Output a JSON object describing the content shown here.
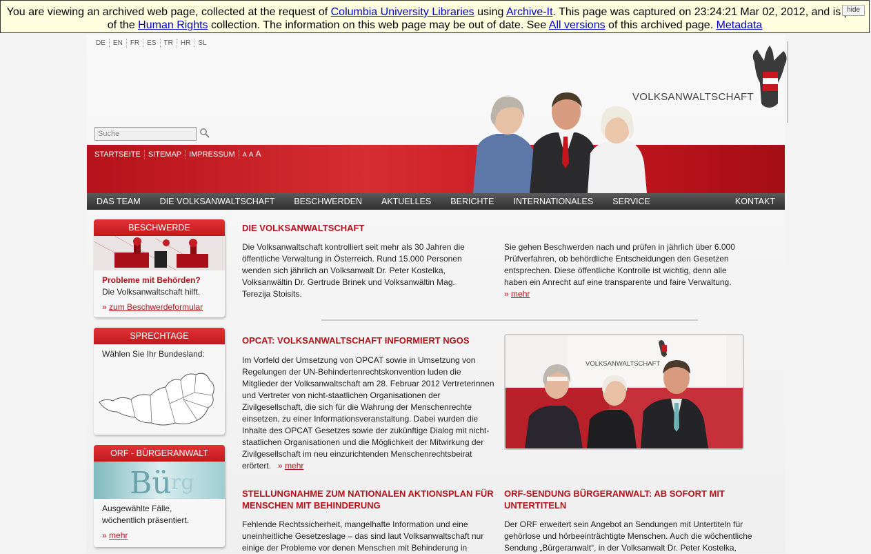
{
  "banner": {
    "text1": "You are viewing an archived web page, collected at the request of ",
    "link1": "Columbia University Libraries",
    "text2": " using ",
    "link2": "Archive-It",
    "text3": ". This page was captured on 23:24:21 Mar 02, 2012, and is part of the ",
    "link3": "Human Rights",
    "text4": " collection. The information on this web page may be out of date. See ",
    "link4": "All versions",
    "text5": " of this archived page. ",
    "link5": "Metadata",
    "hide": "hide"
  },
  "languages": [
    "DE",
    "EN",
    "FR",
    "ES",
    "TR",
    "HR",
    "SL"
  ],
  "search": {
    "placeholder": "Suche"
  },
  "logo": "VOLKSANWALTSCHAFT",
  "util": {
    "home": "STARTSEITE",
    "sitemap": "SITEMAP",
    "impressum": "IMPRESSUM",
    "fs1": "A",
    "fs2": "A",
    "fs3": "A"
  },
  "nav": [
    "DAS TEAM",
    "DIE VOLKSANWALTSCHAFT",
    "BESCHWERDEN",
    "AKTUELLES",
    "BERICHTE",
    "INTERNATIONALES",
    "SERVICE"
  ],
  "nav_contact": "KONTAKT",
  "sidebar": {
    "b1": {
      "title": "BESCHWERDE",
      "strong": "Probleme mit Behörden?",
      "text": "Die Volksanwaltschaft hilft.",
      "arrow": "»",
      "link": "zum Beschwerdeformular"
    },
    "b2": {
      "title": "SPRECHTAGE",
      "text": "Wählen Sie Ihr Bundesland:"
    },
    "b3": {
      "title": "ORF - BÜRGERANWALT",
      "text": "Ausgewählte Fälle, wöchentlich präsentiert.",
      "arrow": "»",
      "link": "mehr"
    }
  },
  "main": {
    "a1": {
      "title": "DIE VOLKSANWALTSCHAFT",
      "left": "Die Volksanwaltschaft kontrolliert seit mehr als 30 Jahren die öffentliche Verwaltung in Österreich. Rund 15.000 Personen wenden sich jährlich an Volksanwalt Dr. Peter Kostelka, Volksanwältin Dr. Gertrude Brinek und Volksanwältin Mag. Terezija Stoisits.",
      "right": "Sie gehen Beschwerden nach und prüfen in jährlich über 6.000 Prüfverfahren, ob behördliche Entscheidungen den Gesetzen entsprechen. Diese öffentliche Kontrolle ist wichtig, denn alle haben ein Anrecht auf eine transparente und faire Verwaltung.",
      "arrow": "»",
      "more": "mehr"
    },
    "a2": {
      "title": "OPCAT: VOLKSANWALTSCHAFT INFORMIERT NGOS",
      "text": "Im Vorfeld der Umsetzung von OPCAT sowie in Umsetzung von Regelungen der UN-Behindertenrechtskonvention luden die Mitglieder der Volksanwaltschaft am 28. Februar 2012 Vertreterinnen und Vertreter von nicht-staatlichen Organisationen der Zivilgesellschaft, die sich für die Wahrung der Menschenrechte einsetzen, zu einer Informationsveranstaltung. Dabei wurden die Inhalte des OPCAT Gesetzes  sowie der zukünftige Dialog mit nicht-staatlichen Organisationen und die Möglichkeit der Mitwirkung der Zivilgesellschaft im neu einzurichtenden Menschenrechtsbeirat erörtert.",
      "arrow": "»",
      "more": "mehr",
      "photo_label": "VOLKSANWALTSCHAFT"
    },
    "a3": {
      "title": "STELLUNGNAHME ZUM NATIONALEN AKTIONSPLAN FÜR MENSCHEN MIT BEHINDERUNG",
      "text": "Fehlende Rechtssicherheit, mangelhafte Information und eine uneinheitliche Gesetzeslage – das sind laut Volksanwaltschaft nur einige der Probleme vor denen Menschen mit Behinderung in"
    },
    "a4": {
      "title": "ORF-SENDUNG BÜRGERANWALT: AB SOFORT MIT UNTERTITELN",
      "text": "Der ORF erweitert sein Angebot an Sendungen mit Untertiteln für gehörlose und hörbeeinträchtigte Menschen. Auch die wöchentliche Sendung „Bürgeranwalt“, in der Volksanwalt Dr. Peter Kostelka,"
    }
  },
  "colors": {
    "brand_red": "#b5121b",
    "nav_dark": "#3a3a3a",
    "banner_bg": "#ffffe0"
  }
}
